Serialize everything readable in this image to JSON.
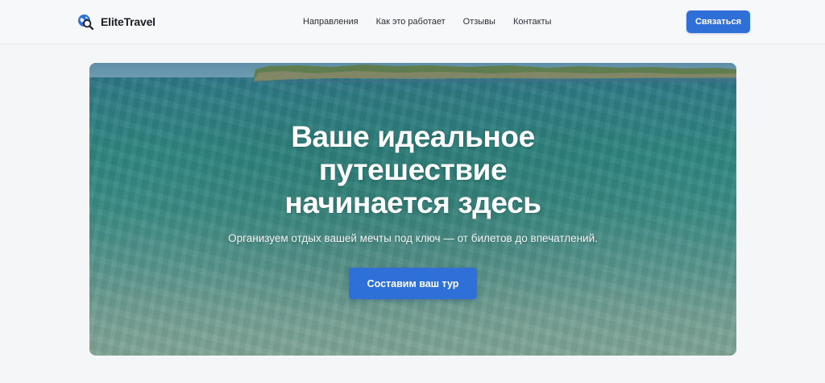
{
  "header": {
    "brand_name": "EliteTravel",
    "nav": [
      {
        "label": "Направления"
      },
      {
        "label": "Как это работает"
      },
      {
        "label": "Отзывы"
      },
      {
        "label": "Контакты"
      }
    ],
    "contact_button": "Связаться"
  },
  "hero": {
    "title": "Ваше идеальное путешествие начинается здесь",
    "subtitle": "Организуем отдых вашей мечты под ключ — от билетов до впечатлений.",
    "cta_button": "Составим ваш тур"
  },
  "colors": {
    "accent": "#2f6fd8",
    "page_background": "#f5f6f8",
    "brand_text": "#1a1d24"
  },
  "icons": {
    "logo": "globe-search-icon"
  }
}
